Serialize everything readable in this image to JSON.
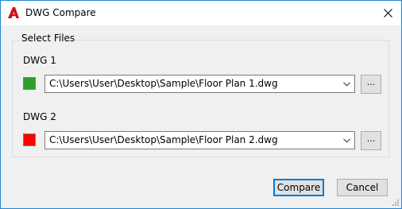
{
  "window": {
    "title": "DWG Compare",
    "app_icon": "autocad-a-icon",
    "close_icon": "close-icon"
  },
  "group": {
    "legend": "Select Files"
  },
  "dwg1": {
    "label": "DWG 1",
    "color": "#2ca02c",
    "path": "C:\\Users\\User\\Desktop\\Sample\\Floor Plan 1.dwg",
    "browse_label": "..."
  },
  "dwg2": {
    "label": "DWG 2",
    "color": "#ff0000",
    "path": "C:\\Users\\User\\Desktop\\Sample\\Floor Plan 2.dwg",
    "browse_label": "..."
  },
  "buttons": {
    "compare_label": "Compare",
    "cancel_label": "Cancel"
  },
  "colors": {
    "accent": "#0078d7",
    "app_icon_red": "#d0121a"
  }
}
